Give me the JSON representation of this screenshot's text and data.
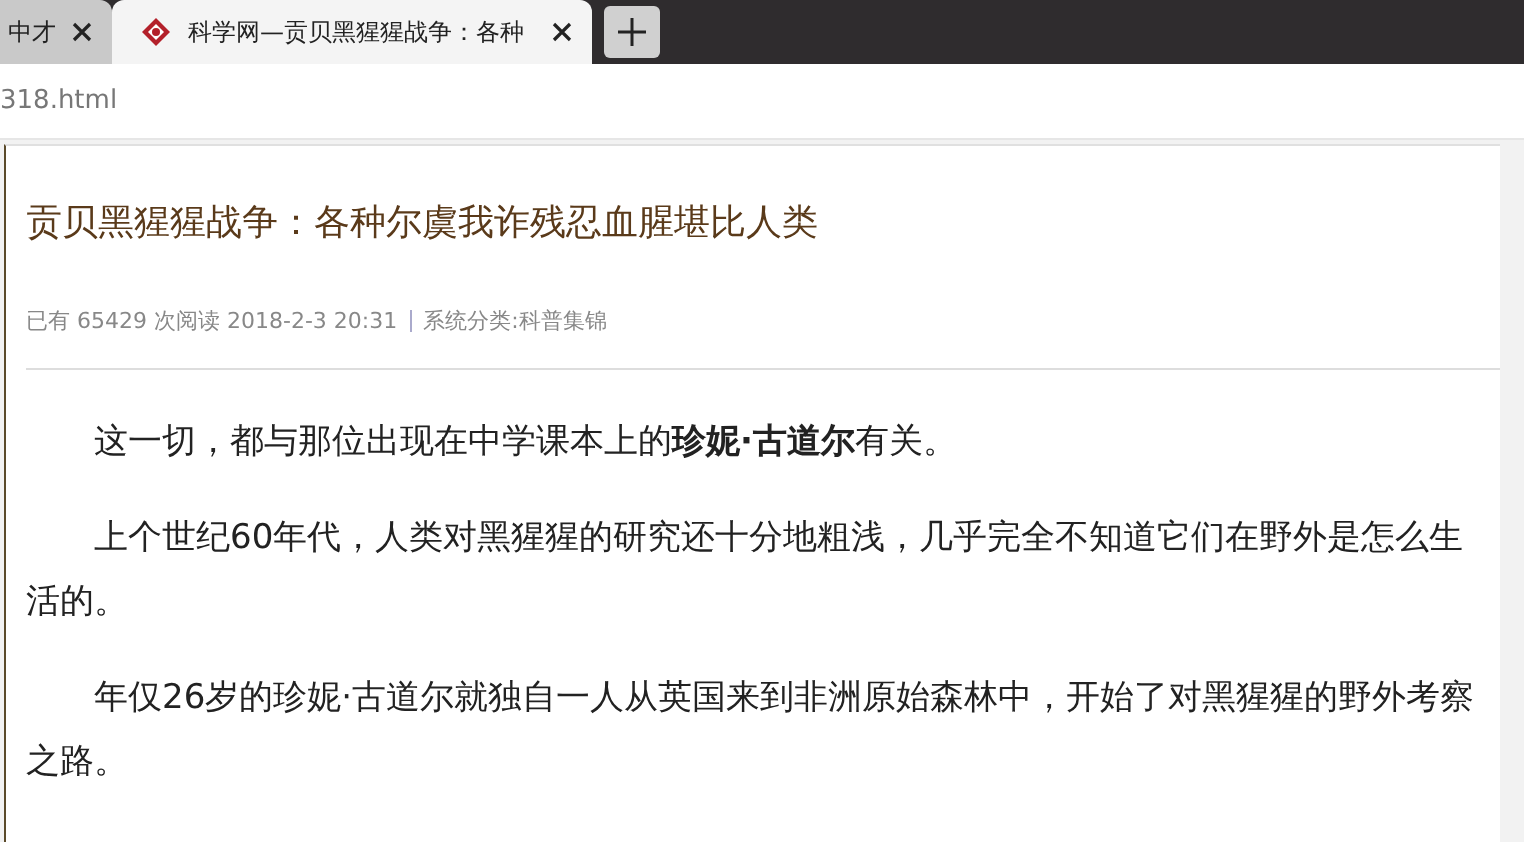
{
  "tabs": [
    {
      "title": "中才",
      "selected": false
    },
    {
      "title": "科学网—贡贝黑猩猩战争：各种",
      "selected": true
    }
  ],
  "address": "318.html",
  "article": {
    "title": "贡贝黑猩猩战争：各种尔虞我诈残忍血腥堪比人类",
    "meta": "已有 65429 次阅读 2018-2-3 20:31",
    "category": "系统分类:科普集锦",
    "paragraphs": [
      "这一切，都与那位出现在中学课本上的**珍妮·古道尔**有关。",
      "上个世纪60年代，人类对黑猩猩的研究还十分地粗浅，几乎完全不知道它们在野外是怎么生活的。",
      "年仅26岁的珍妮·古道尔就独自一人从英国来到非洲原始森林中，开始了对黑猩猩的野外考察之路。"
    ]
  }
}
